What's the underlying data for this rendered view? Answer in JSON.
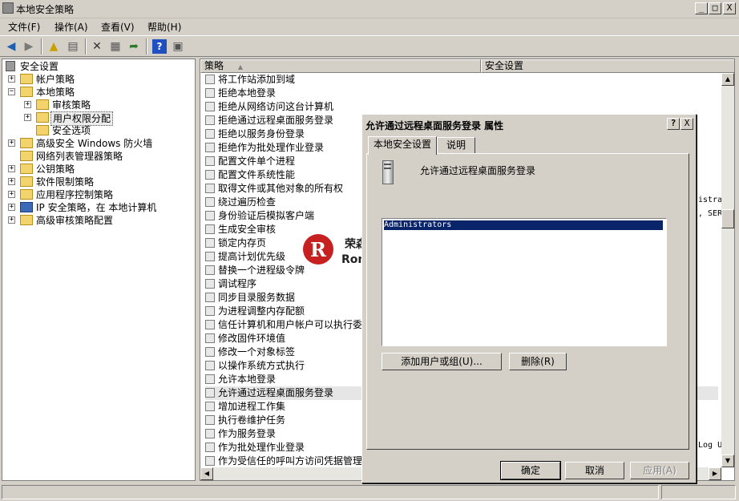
{
  "window": {
    "title": "本地安全策略",
    "min_label": "_",
    "max_label": "□",
    "close_label": "X"
  },
  "menu": [
    {
      "label": "文件(F)"
    },
    {
      "label": "操作(A)"
    },
    {
      "label": "查看(V)"
    },
    {
      "label": "帮助(H)"
    }
  ],
  "tree": {
    "root": "安全设置",
    "items": [
      {
        "label": "帐户策略"
      },
      {
        "label": "本地策略"
      },
      {
        "label": "审核策略"
      },
      {
        "label": "用户权限分配"
      },
      {
        "label": "安全选项"
      },
      {
        "label": "高级安全 Windows 防火墙"
      },
      {
        "label": "网络列表管理器策略"
      },
      {
        "label": "公钥策略"
      },
      {
        "label": "软件限制策略"
      },
      {
        "label": "应用程序控制策略"
      },
      {
        "label": "IP 安全策略，在 本地计算机"
      },
      {
        "label": "高级审核策略配置"
      }
    ]
  },
  "list": {
    "col_policy": "策略",
    "col_setting": "安全设置",
    "rows": [
      {
        "policy": "将工作站添加到域"
      },
      {
        "policy": "拒绝本地登录"
      },
      {
        "policy": "拒绝从网络访问这台计算机"
      },
      {
        "policy": "拒绝通过远程桌面服务登录"
      },
      {
        "policy": "拒绝以服务身份登录"
      },
      {
        "policy": "拒绝作为批处理作业登录"
      },
      {
        "policy": "配置文件单个进程"
      },
      {
        "policy": "配置文件系统性能"
      },
      {
        "policy": "取得文件或其他对象的所有权"
      },
      {
        "policy": "绕过遍历检查"
      },
      {
        "policy": "身份验证后模拟客户端"
      },
      {
        "policy": "生成安全审核"
      },
      {
        "policy": "锁定内存页"
      },
      {
        "policy": "提高计划优先级"
      },
      {
        "policy": "替换一个进程级令牌"
      },
      {
        "policy": "调试程序"
      },
      {
        "policy": "同步目录服务数据"
      },
      {
        "policy": "为进程调整内存配额"
      },
      {
        "policy": "信任计算机和用户帐户可以执行委"
      },
      {
        "policy": "修改固件环境值"
      },
      {
        "policy": "修改一个对象标签"
      },
      {
        "policy": "以操作系统方式执行"
      },
      {
        "policy": "允许本地登录"
      },
      {
        "policy": "允许通过远程桌面服务登录"
      },
      {
        "policy": "增加进程工作集"
      },
      {
        "policy": "执行卷维护任务"
      },
      {
        "policy": "作为服务登录"
      },
      {
        "policy": "作为批处理作业登录"
      },
      {
        "policy": "作为受信任的呼叫方访问凭据管理"
      }
    ],
    "setting_fragments": [
      "istra",
      ", SERV",
      "Log U"
    ]
  },
  "dialog": {
    "title": "允许通过远程桌面服务登录 属性",
    "help_label": "?",
    "close_label": "X",
    "tabs": [
      {
        "label": "本地安全设置"
      },
      {
        "label": "说明"
      }
    ],
    "policy_name": "允许通过远程桌面服务登录",
    "users": [
      "Administrators"
    ],
    "add_button": "添加用户或组(U)...",
    "remove_button": "删除(R)",
    "ok_button": "确定",
    "cancel_button": "取消",
    "apply_button": "应用(A)"
  },
  "watermark": {
    "line1": "荣森网安网站维护",
    "line2": "Rongsen.Com.Cn"
  },
  "colors": {
    "selection": "#0a246a",
    "face": "#d4d0c8"
  }
}
